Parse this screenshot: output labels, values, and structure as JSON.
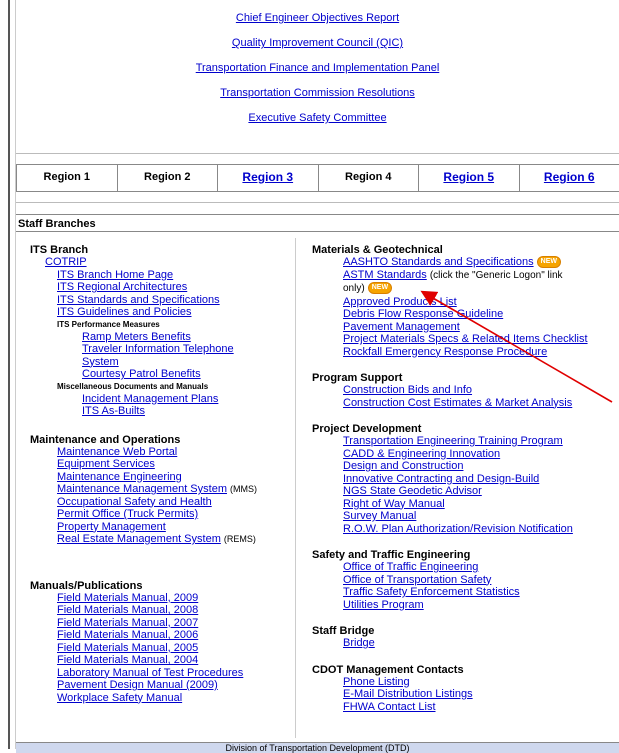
{
  "top_links": [
    "Chief Engineer Objectives Report",
    "Quality Improvement Council (QIC)",
    "Transportation Finance and Implementation Panel",
    "Transportation Commission Resolutions",
    "Executive Safety Committee"
  ],
  "regions": [
    {
      "label": "Region 1",
      "link": false
    },
    {
      "label": "Region 2",
      "link": false
    },
    {
      "label": "Region 3",
      "link": true
    },
    {
      "label": "Region 4",
      "link": false
    },
    {
      "label": "Region 5",
      "link": true
    },
    {
      "label": "Region 6",
      "link": true
    }
  ],
  "staff_branches_label": "Staff Branches",
  "left": {
    "its": {
      "title": "ITS Branch",
      "links": [
        "COTRIP",
        "ITS Branch Home Page",
        "ITS Regional Architectures",
        "ITS Standards and Specifications",
        "ITS Guidelines and Policies"
      ],
      "perf_title": "ITS Performance Measures",
      "perf_links": [
        "Ramp Meters Benefits",
        "Traveler Information Telephone",
        "System",
        "Courtesy Patrol Benefits"
      ],
      "misc_title": "Miscellaneous Documents and Manuals",
      "misc_links": [
        "Incident Management Plans",
        "ITS As-Builts"
      ]
    },
    "maint": {
      "title": "Maintenance and Operations",
      "links": [
        "Maintenance Web Portal",
        "Equipment Services",
        "Maintenance Engineering",
        "Maintenance Management System",
        "Occupational Safety and Health",
        "Permit Office (Truck Permits)",
        "Property Management",
        "Real Estate Management System"
      ],
      "mms_note": "(MMS)",
      "rems_note": "(REMS)"
    },
    "manuals": {
      "title": "Manuals/Publications",
      "links": [
        "Field Materials Manual, 2009",
        "Field Materials Manual, 2008",
        "Field Materials Manual, 2007",
        "Field Materials Manual, 2006",
        "Field Materials Manual, 2005",
        "Field Materials Manual, 2004",
        "Laboratory Manual of Test Procedures",
        "Pavement Design Manual (2009)",
        "Workplace Safety Manual"
      ]
    }
  },
  "right": {
    "materials": {
      "title": "Materials & Geotechnical",
      "aashto": "AASHTO Standards and Specifications",
      "astm": "ASTM Standards",
      "astm_note": "(click the \"Generic Logon\" link",
      "astm_note2": "only)",
      "links": [
        "Approved Products List",
        "Debris Flow Response Guideline",
        "Pavement Management",
        "Project Materials Specs & Related Items Checklist",
        "Rockfall Emergency Response Procedure"
      ],
      "new_badge": "NEW"
    },
    "program": {
      "title": "Program Support",
      "links": [
        "Construction Bids and Info",
        "Construction Cost Estimates & Market Analysis"
      ]
    },
    "projdev": {
      "title": "Project Development",
      "links": [
        "Transportation Engineering Training Program",
        "CADD & Engineering Innovation",
        "Design and Construction",
        "Innovative Contracting and Design-Build",
        "NGS State Geodetic Advisor",
        "Right of Way Manual",
        "Survey Manual",
        "R.O.W. Plan Authorization/Revision Notification"
      ]
    },
    "safety": {
      "title": "Safety and Traffic Engineering",
      "links": [
        "Office of Traffic Engineering",
        "Office of Transportation Safety",
        "Traffic Safety Enforcement Statistics",
        "Utilities Program"
      ]
    },
    "bridge": {
      "title": "Staff Bridge",
      "links": [
        "Bridge"
      ]
    },
    "contacts": {
      "title": "CDOT Management Contacts",
      "links": [
        "Phone Listing",
        "E-Mail Distribution Listings",
        "FHWA Contact List"
      ]
    }
  },
  "footer_text": "Division of Transportation Development (DTD)",
  "colors": {
    "link": "#0000cc",
    "arrow": "#e00000",
    "badge": "#f6a400"
  }
}
